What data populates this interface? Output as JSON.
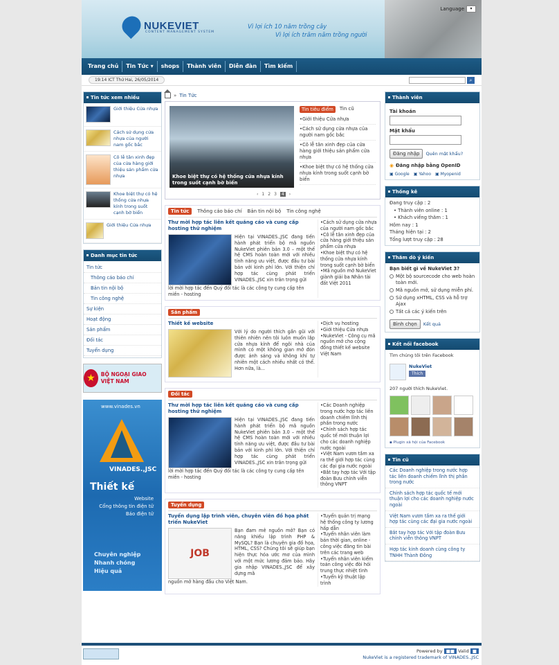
{
  "header": {
    "logo_text": "NUKEVIET",
    "logo_sub": "CONTENT MANAGEMENT SYSTEM",
    "slogan1": "Vì lợi ích 10 năm trồng cây",
    "slogan2": "Vì lợi ích trăm năm trồng người",
    "language_label": "Language"
  },
  "nav": [
    "Trang chủ",
    "Tin Tức ▾",
    "shops",
    "Thành viên",
    "Diễn đàn",
    "Tìm kiếm"
  ],
  "datetime": "19:14 ICT  Thứ Hai, 26/05/2014",
  "left": {
    "hot_title": "Tin tức xem nhiều",
    "hot_items": [
      "Giới thiệu Cửa nhựa",
      "Cách sử dụng cửa nhựa của người nam gốc bắc",
      "Cô lễ tân xinh đẹp của cửa hàng giới thiệu sản phẩm cửa nhựa",
      "Khoe biệt thự có hệ thống cửa nhựa kính trong suốt cạnh bờ biển",
      "Giới thiệu Cửa nhựa"
    ],
    "cat_title": "Danh mục tin tức",
    "cats": [
      {
        "label": "Tin tức",
        "sub": false
      },
      {
        "label": "Thông cáo báo chí",
        "sub": true
      },
      {
        "label": "Bản tin nội bộ",
        "sub": true
      },
      {
        "label": "Tin công nghệ",
        "sub": true
      },
      {
        "label": "Sự kiện",
        "sub": false
      },
      {
        "label": "Hoạt động",
        "sub": false
      },
      {
        "label": "Sản phẩm",
        "sub": false
      },
      {
        "label": "Đối tác",
        "sub": false
      },
      {
        "label": "Tuyển dụng",
        "sub": false
      }
    ],
    "bng_text": "BỘ NGOẠI GIAO VIỆT NAM",
    "vinades": {
      "url": "www.vinades.vn",
      "name": "VINADES.,JSC",
      "big": "Thiết kế",
      "lines": [
        "Website",
        "Cổng thông tin điện tử",
        "Báo điện tử"
      ],
      "bottom": [
        "Chuyên nghiệp",
        "Nhanh chóng",
        "Hiệu quả"
      ]
    }
  },
  "mid": {
    "crumb": "Tin Tức",
    "featured": {
      "caption": "Khoe biệt thự có hệ thống cửa nhựa kính trong suốt cạnh bờ biển",
      "tab_on": "Tin tiêu điểm",
      "tab_off": "Tin cũ",
      "list": [
        "Giới thiệu Cửa nhựa",
        "Cách sử dụng cửa nhựa của người nam gốc bắc",
        "Cô lễ tân xinh đẹp của cửa hàng giới thiệu sản phẩm cửa nhựa",
        "Khoe biệt thự có hệ thống cửa nhựa kính trong suốt cạnh bờ biển"
      ],
      "pages": [
        "1",
        "2",
        "3",
        "4"
      ]
    },
    "sections": [
      {
        "title": "Tin tức",
        "tabs": [
          "Thông cáo báo chí",
          "Bản tin nội bộ",
          "Tin công nghệ"
        ],
        "headline": "Thư mời hợp tác liên kết quảng cáo và cung cấp hosting thử nghiệm",
        "text": "Hiện tại VINADES.,JSC đang tiến hành phát triển bộ mã nguồn NukeViet phiên bản 3.0 – một thế hệ CMS hoàn toàn mới với nhiều tính năng ưu việt, được đầu tư bài bản với kinh phí lớn. Với thiện chí hợp tác cùng phát triển VINADES.,JSC xin trân trọng gửi",
        "tail": "lời mời hợp tác đến Quý đối tác là các công ty cung cấp tên miền - hosting",
        "side": [
          "Cách sử dụng cửa nhựa của người nam gốc bắc",
          "Cô lễ tân xinh đẹp của cửa hàng giới thiệu sản phẩm cửa nhựa",
          "Khoe biệt thự có hệ thống cửa nhựa kính trong suốt cạnh bờ biển",
          "Mã nguồn mở NukeViet giành giải ba Nhân tài đất Việt 2011"
        ]
      },
      {
        "title": "Sản phẩm",
        "tabs": [],
        "headline": "Thiết kế website",
        "text": "Với lý do người thích gần gũi với thiên nhiên nên tôi luôn muốn lắp cửa nhựa kính để ngôi nhà của mình có một không gian mở đón được ánh sáng và không khí tự nhiên một cách nhiều nhất có thể. Hơn nữa, là...",
        "tail": "",
        "side": [
          "Dịch vụ hosting",
          "Giới thiệu Cửa nhựa",
          "NukeViet - Công cụ mã nguồn mở cho cộng đồng thiết kế website Việt Nam"
        ]
      },
      {
        "title": "Đối tác",
        "tabs": [],
        "headline": "Thư mời hợp tác liên kết quảng cáo và cung cấp hosting thử nghiệm",
        "text": "Hiện tại VINADES.,JSC đang tiến hành phát triển bộ mã nguồn NukeViet phiên bản 3.0 – một thế hệ CMS hoàn toàn mới với nhiều tính năng ưu việt, được đầu tư bài bản với kinh phí lớn. Với thiện chí hợp tác cùng phát triển VINADES.,JSC xin trân trọng gửi",
        "tail": "lời mời hợp tác đến Quý đối tác là các công ty cung cấp tên miền - hosting",
        "side": [
          "Các Doanh nghiệp trong nước hợp tác liên doanh chiếm lĩnh thị phần trong nước",
          "Chính sách hợp tác quốc tế mới thuận lợi cho các doanh nghiệp nước ngoài",
          "Việt Nam vươn tầm xa ra thế giới hợp tác cùng các đại gia nước ngoài",
          "Bắt tay hợp tác Với tập đoàn Bưu chính viễn thông VNPT"
        ]
      },
      {
        "title": "Tuyển dụng",
        "tabs": [],
        "headline": "Tuyển dụng lập trình viên, chuyên viên đồ họa phát triển NukeViet",
        "text": "Bạn đam mê nguồn mở? Bạn có năng khiếu lập trình PHP & MySQL? Bạn là chuyên gia đồ họa, HTML, CSS? Chúng tôi sẽ giúp bạn hiện thực hóa ước mơ của mình với một mức lương đảm bảo. Hãy gia nhập VINADES.,JSC để xây dựng mã",
        "tail": "nguồn mở hàng đầu cho Việt Nam.",
        "side": [
          "Tuyển quản trị mạng hệ thống công ty lương hấp dẫn",
          "Tuyển nhân viên làm bán thời gian, online - công việc đăng tin bài trên các trang web",
          "Tuyển nhân viên kiểm toán công việc đòi hỏi trung thực nhiệt tình",
          "Tuyển kỹ thuật lập trình"
        ]
      }
    ]
  },
  "right": {
    "member_title": "Thành viên",
    "user_label": "Tài khoản",
    "pass_label": "Mật khẩu",
    "login_btn": "Đăng nhập",
    "forgot": "Quên mật khẩu?",
    "openid": "Đăng nhập bằng OpenID",
    "providers": [
      "Google",
      "Yahoo",
      "Myopenid"
    ],
    "stats_title": "Thống kê",
    "stats": [
      "Đang truy cập : 2",
      "• Thành viên online : 1",
      "• Khách viếng thăm : 1",
      "Hôm nay : 1",
      "Tháng hiện tại : 2",
      "Tổng lượt truy cập : 28"
    ],
    "poll_title": "Thăm dò ý kiến",
    "poll_q": "Bạn biết gì về NukeViet 3?",
    "poll_opts": [
      "Một bộ sourcecode cho web hoàn toàn mới.",
      "Mã nguồn mở, sử dụng miễn phí.",
      "Sử dụng xHTML, CSS và hỗ trợ Ajax",
      "Tất cả các ý kiến trên"
    ],
    "poll_btn": "Bình chọn",
    "poll_result": "Kết quả",
    "fb_title": "Kết nối facebook",
    "fb_find": "Tìm chúng tôi trên Facebook",
    "fb_name": "NukeViet",
    "fb_like": "Thích",
    "fb_count": "207 người thích NukeViet.",
    "fb_plugin": "Plugin xã hội của Facebook",
    "old_title": "Tin cũ",
    "old_news": [
      "Các Doanh nghiệp trong nước hợp tác liên doanh chiếm lĩnh thị phần trong nước",
      "Chính sách hợp tác quốc tế mới thuận lợi cho các doanh nghiệp nước ngoài",
      "Việt Nam vươn tầm xa ra thế giới hợp tác cùng các đại gia nước ngoài",
      "Bắt tay hợp tác Với tập đoàn Bưu chính viễn thông VNPT",
      "Hợp tác kinh doanh cùng công ty TNHH Thành Đông"
    ]
  },
  "footer": {
    "powered": "Powered by",
    "valid": "Valid",
    "trademark": "NukeViet is a registered trademark of VINADES.,JSC"
  }
}
